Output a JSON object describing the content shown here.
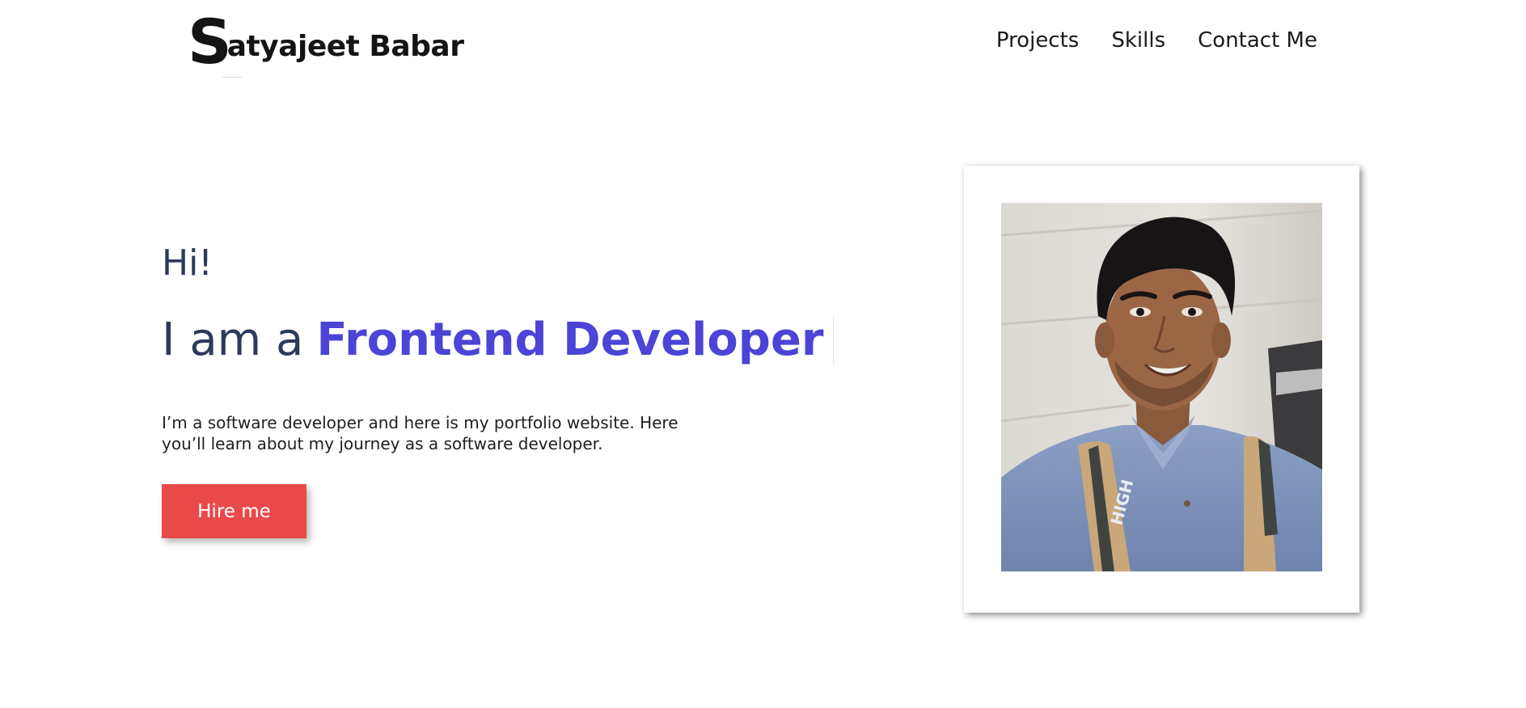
{
  "header": {
    "logo": {
      "initial": "S",
      "rest": "atyajeet Babar"
    },
    "nav": [
      {
        "label": "Projects"
      },
      {
        "label": "Skills"
      },
      {
        "label": "Contact Me"
      }
    ]
  },
  "hero": {
    "greeting": "Hi!",
    "headline_prefix": "I am a",
    "role": "Frontend Developer",
    "description": "I’m a software developer and here is my portfolio website. Here you’ll learn about my journey as a software developer.",
    "cta_label": "Hire me"
  },
  "colors": {
    "accent": "#4b44d6",
    "cta": "#e84a4a",
    "heading": "#2d3a5c",
    "text": "#1f1f1f"
  }
}
